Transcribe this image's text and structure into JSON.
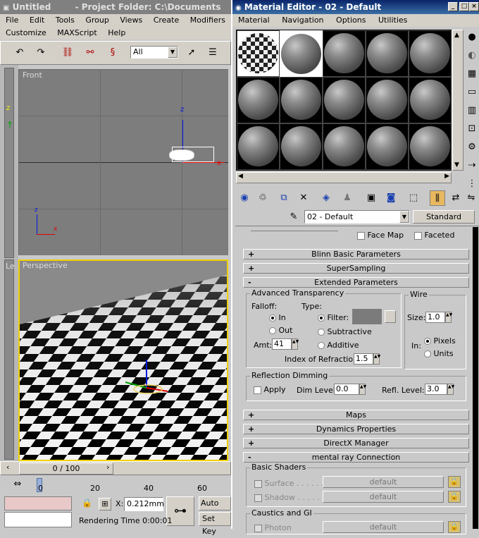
{
  "main_window": {
    "title": "Untitled",
    "project": "- Project Folder: C:\\Documents",
    "menu": [
      "File",
      "Edit",
      "Tools",
      "Group",
      "Views",
      "Create",
      "Modifiers"
    ],
    "menu2": [
      "Customize",
      "MAXScript",
      "Help"
    ],
    "selection_filter": "All"
  },
  "viewports": {
    "top_label": "Front",
    "persp_label": "Perspective",
    "side_label": "Le"
  },
  "timeline": {
    "frame_label": "0 / 100",
    "ticks": [
      "0",
      "20",
      "40",
      "60"
    ]
  },
  "status": {
    "x_label": "X:",
    "x_value": "0.212mm",
    "auto_key": "Auto Key",
    "set_key": "Set Key",
    "rendering_time": "Rendering Time  0:00:01"
  },
  "material_editor": {
    "title": "Material Editor - 02 - Default",
    "menu": [
      "Material",
      "Navigation",
      "Options",
      "Utilities"
    ],
    "material_name": "02 - Default",
    "material_type": "Standard",
    "face_map": "Face Map",
    "faceted": "Faceted",
    "rollouts": {
      "blinn": "Blinn Basic Parameters",
      "supersampling": "SuperSampling",
      "extended": "Extended Parameters",
      "maps": "Maps",
      "dynamics": "Dynamics Properties",
      "directx": "DirectX Manager",
      "mental_ray": "mental ray Connection"
    },
    "advanced_transparency": {
      "group": "Advanced Transparency",
      "falloff": "Falloff:",
      "type": "Type:",
      "in": "In",
      "out": "Out",
      "filter": "Filter:",
      "subtractive": "Subtractive",
      "additive": "Additive",
      "amt_label": "Amt:",
      "amt_value": "41",
      "ior_label": "Index of Refraction:",
      "ior_value": "1.5"
    },
    "wire": {
      "group": "Wire",
      "size_label": "Size:",
      "size_value": "1.0",
      "in_label": "In:",
      "pixels": "Pixels",
      "units": "Units"
    },
    "reflection_dimming": {
      "group": "Reflection Dimming",
      "apply": "Apply",
      "dim_label": "Dim Level:",
      "dim_value": "0.0",
      "refl_label": "Refl. Level:",
      "refl_value": "3.0"
    },
    "basic_shaders": {
      "group": "Basic Shaders",
      "surface": "Surface . . . . . .",
      "shadow": "Shadow . . . . . .",
      "default": "default"
    },
    "caustics": {
      "group": "Caustics and GI",
      "photon": "Photon"
    }
  }
}
